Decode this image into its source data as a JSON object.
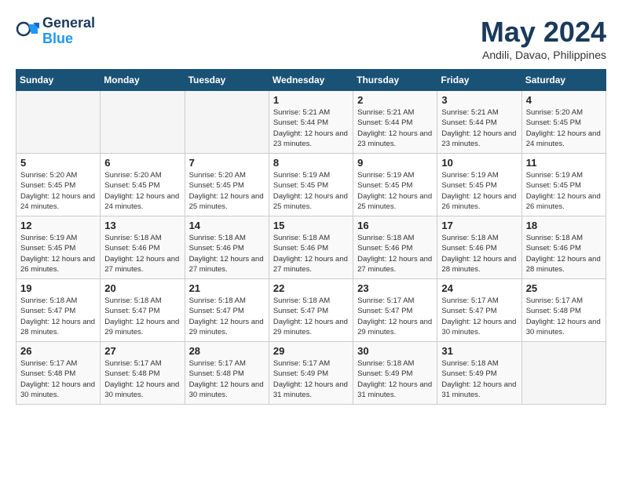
{
  "header": {
    "logo_line1": "General",
    "logo_line2": "Blue",
    "month": "May 2024",
    "location": "Andili, Davao, Philippines"
  },
  "weekdays": [
    "Sunday",
    "Monday",
    "Tuesday",
    "Wednesday",
    "Thursday",
    "Friday",
    "Saturday"
  ],
  "weeks": [
    [
      {
        "day": "",
        "sunrise": "",
        "sunset": "",
        "daylight": "",
        "empty": true
      },
      {
        "day": "",
        "sunrise": "",
        "sunset": "",
        "daylight": "",
        "empty": true
      },
      {
        "day": "",
        "sunrise": "",
        "sunset": "",
        "daylight": "",
        "empty": true
      },
      {
        "day": "1",
        "sunrise": "Sunrise: 5:21 AM",
        "sunset": "Sunset: 5:44 PM",
        "daylight": "Daylight: 12 hours and 23 minutes."
      },
      {
        "day": "2",
        "sunrise": "Sunrise: 5:21 AM",
        "sunset": "Sunset: 5:44 PM",
        "daylight": "Daylight: 12 hours and 23 minutes."
      },
      {
        "day": "3",
        "sunrise": "Sunrise: 5:21 AM",
        "sunset": "Sunset: 5:44 PM",
        "daylight": "Daylight: 12 hours and 23 minutes."
      },
      {
        "day": "4",
        "sunrise": "Sunrise: 5:20 AM",
        "sunset": "Sunset: 5:45 PM",
        "daylight": "Daylight: 12 hours and 24 minutes."
      }
    ],
    [
      {
        "day": "5",
        "sunrise": "Sunrise: 5:20 AM",
        "sunset": "Sunset: 5:45 PM",
        "daylight": "Daylight: 12 hours and 24 minutes."
      },
      {
        "day": "6",
        "sunrise": "Sunrise: 5:20 AM",
        "sunset": "Sunset: 5:45 PM",
        "daylight": "Daylight: 12 hours and 24 minutes."
      },
      {
        "day": "7",
        "sunrise": "Sunrise: 5:20 AM",
        "sunset": "Sunset: 5:45 PM",
        "daylight": "Daylight: 12 hours and 25 minutes."
      },
      {
        "day": "8",
        "sunrise": "Sunrise: 5:19 AM",
        "sunset": "Sunset: 5:45 PM",
        "daylight": "Daylight: 12 hours and 25 minutes."
      },
      {
        "day": "9",
        "sunrise": "Sunrise: 5:19 AM",
        "sunset": "Sunset: 5:45 PM",
        "daylight": "Daylight: 12 hours and 25 minutes."
      },
      {
        "day": "10",
        "sunrise": "Sunrise: 5:19 AM",
        "sunset": "Sunset: 5:45 PM",
        "daylight": "Daylight: 12 hours and 26 minutes."
      },
      {
        "day": "11",
        "sunrise": "Sunrise: 5:19 AM",
        "sunset": "Sunset: 5:45 PM",
        "daylight": "Daylight: 12 hours and 26 minutes."
      }
    ],
    [
      {
        "day": "12",
        "sunrise": "Sunrise: 5:19 AM",
        "sunset": "Sunset: 5:45 PM",
        "daylight": "Daylight: 12 hours and 26 minutes."
      },
      {
        "day": "13",
        "sunrise": "Sunrise: 5:18 AM",
        "sunset": "Sunset: 5:46 PM",
        "daylight": "Daylight: 12 hours and 27 minutes."
      },
      {
        "day": "14",
        "sunrise": "Sunrise: 5:18 AM",
        "sunset": "Sunset: 5:46 PM",
        "daylight": "Daylight: 12 hours and 27 minutes."
      },
      {
        "day": "15",
        "sunrise": "Sunrise: 5:18 AM",
        "sunset": "Sunset: 5:46 PM",
        "daylight": "Daylight: 12 hours and 27 minutes."
      },
      {
        "day": "16",
        "sunrise": "Sunrise: 5:18 AM",
        "sunset": "Sunset: 5:46 PM",
        "daylight": "Daylight: 12 hours and 27 minutes."
      },
      {
        "day": "17",
        "sunrise": "Sunrise: 5:18 AM",
        "sunset": "Sunset: 5:46 PM",
        "daylight": "Daylight: 12 hours and 28 minutes."
      },
      {
        "day": "18",
        "sunrise": "Sunrise: 5:18 AM",
        "sunset": "Sunset: 5:46 PM",
        "daylight": "Daylight: 12 hours and 28 minutes."
      }
    ],
    [
      {
        "day": "19",
        "sunrise": "Sunrise: 5:18 AM",
        "sunset": "Sunset: 5:47 PM",
        "daylight": "Daylight: 12 hours and 28 minutes."
      },
      {
        "day": "20",
        "sunrise": "Sunrise: 5:18 AM",
        "sunset": "Sunset: 5:47 PM",
        "daylight": "Daylight: 12 hours and 29 minutes."
      },
      {
        "day": "21",
        "sunrise": "Sunrise: 5:18 AM",
        "sunset": "Sunset: 5:47 PM",
        "daylight": "Daylight: 12 hours and 29 minutes."
      },
      {
        "day": "22",
        "sunrise": "Sunrise: 5:18 AM",
        "sunset": "Sunset: 5:47 PM",
        "daylight": "Daylight: 12 hours and 29 minutes."
      },
      {
        "day": "23",
        "sunrise": "Sunrise: 5:17 AM",
        "sunset": "Sunset: 5:47 PM",
        "daylight": "Daylight: 12 hours and 29 minutes."
      },
      {
        "day": "24",
        "sunrise": "Sunrise: 5:17 AM",
        "sunset": "Sunset: 5:47 PM",
        "daylight": "Daylight: 12 hours and 30 minutes."
      },
      {
        "day": "25",
        "sunrise": "Sunrise: 5:17 AM",
        "sunset": "Sunset: 5:48 PM",
        "daylight": "Daylight: 12 hours and 30 minutes."
      }
    ],
    [
      {
        "day": "26",
        "sunrise": "Sunrise: 5:17 AM",
        "sunset": "Sunset: 5:48 PM",
        "daylight": "Daylight: 12 hours and 30 minutes."
      },
      {
        "day": "27",
        "sunrise": "Sunrise: 5:17 AM",
        "sunset": "Sunset: 5:48 PM",
        "daylight": "Daylight: 12 hours and 30 minutes."
      },
      {
        "day": "28",
        "sunrise": "Sunrise: 5:17 AM",
        "sunset": "Sunset: 5:48 PM",
        "daylight": "Daylight: 12 hours and 30 minutes."
      },
      {
        "day": "29",
        "sunrise": "Sunrise: 5:17 AM",
        "sunset": "Sunset: 5:49 PM",
        "daylight": "Daylight: 12 hours and 31 minutes."
      },
      {
        "day": "30",
        "sunrise": "Sunrise: 5:18 AM",
        "sunset": "Sunset: 5:49 PM",
        "daylight": "Daylight: 12 hours and 31 minutes."
      },
      {
        "day": "31",
        "sunrise": "Sunrise: 5:18 AM",
        "sunset": "Sunset: 5:49 PM",
        "daylight": "Daylight: 12 hours and 31 minutes."
      },
      {
        "day": "",
        "sunrise": "",
        "sunset": "",
        "daylight": "",
        "empty": true
      }
    ]
  ]
}
